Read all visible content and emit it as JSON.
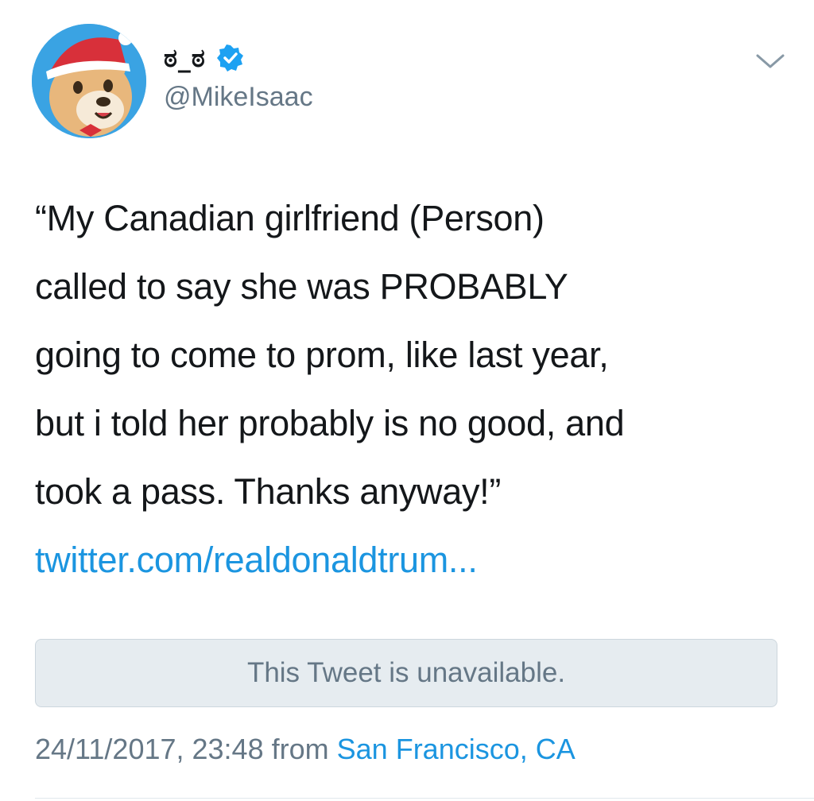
{
  "tweet": {
    "display_name": "ಠ_ಠ",
    "verified": true,
    "handle": "@MikeIsaac",
    "text_lines": [
      "“My Canadian girlfriend (Person)",
      "called to say she was PROBABLY",
      "going to come to prom, like last year,",
      "but i told her probably is no good, and",
      "took a pass. Thanks anyway!”"
    ],
    "link": "twitter.com/realdonaldtrum...",
    "quoted_tweet_status": "This Tweet is unavailable.",
    "timestamp": "24/11/2017, 23:48",
    "from_label": "from",
    "location": "San Francisco, CA"
  },
  "icons": {
    "avatar": "avatar-bear-santa-hat",
    "verified": "verified-badge-icon",
    "menu": "chevron-down-icon"
  },
  "colors": {
    "link_blue": "#1b95e0",
    "secondary_text": "#657786",
    "primary_text": "#14171a",
    "quote_bg": "#e6ecf0"
  }
}
